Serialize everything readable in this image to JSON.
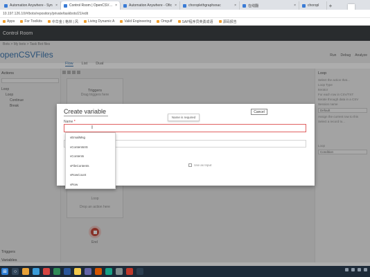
{
  "browser": {
    "tabs": [
      {
        "title": "Automation Anywhere - Syn",
        "active": false
      },
      {
        "title": "Control Room | OpenCSVFile",
        "active": true
      },
      {
        "title": "Automation Anywhere - Ofic",
        "active": false
      },
      {
        "title": "choroplethgraphsnac",
        "active": false
      },
      {
        "title": "在线翻",
        "active": false
      },
      {
        "title": "choropl",
        "active": false
      }
    ],
    "new_tab": "+",
    "address": "10.197.126.10/#/bots/repository/private/taskbots/21/edit",
    "bookmarks": [
      "Apps",
      "For Toolkits",
      "中华金 | 格林 | 风",
      "Living Dynamic A",
      "Valid Engineering",
      "Omguff",
      "SAP程序员英勇成语",
      "源码报告"
    ]
  },
  "app": {
    "brand": "Control Room",
    "breadcrumb": "Bots > My bots > Task Bot files",
    "flow_title": "openCSVFiles",
    "header_actions": [
      "Run",
      "Debug",
      "Analyze"
    ],
    "view_tabs": [
      "Flow",
      "List",
      "Dual"
    ]
  },
  "left_panel": {
    "heading": "Actions",
    "items": [
      "Loop",
      "Loop",
      "Continue",
      "Break"
    ],
    "bottom": [
      "Triggers",
      "Variables"
    ]
  },
  "canvas": {
    "block_heading": "Triggers",
    "block_text": "Drag triggers here",
    "block_footer_label": "Loop",
    "block_footer_text": "Drop an action here",
    "end_label": "End"
  },
  "right_panel": {
    "heading": "Loop",
    "lines": [
      "Select the action that...",
      "Loop Type",
      "Iterator",
      "For each row in CSV/TXT",
      "Iterate through data in a CSV",
      "Session name",
      "Default",
      "Assign the current row to this",
      "Select a record to..."
    ],
    "select_label": "Loop",
    "select_value": "Condition"
  },
  "modal": {
    "title": "Create variable",
    "cancel_label": "Cancel",
    "tooltip": "Name is required",
    "name_label": "Name",
    "required_mark": "*",
    "checkbox_label": "Use as Input",
    "name_value": "",
    "dropdown_options": [
      "vEmailMsg",
      "vContentsIIS",
      "vContents",
      "vFileContents",
      "vRowCount",
      "vRow"
    ]
  },
  "taskbar": {
    "icons": [
      "windows-icon",
      "search-icon",
      "chrome-icon",
      "explorer-icon",
      "mail-icon",
      "folder-icon",
      "excel-icon",
      "word-icon",
      "teams-icon",
      "ie-icon",
      "java-icon",
      "app-icon",
      "player-icon",
      "record-icon",
      "terminal-icon"
    ]
  }
}
